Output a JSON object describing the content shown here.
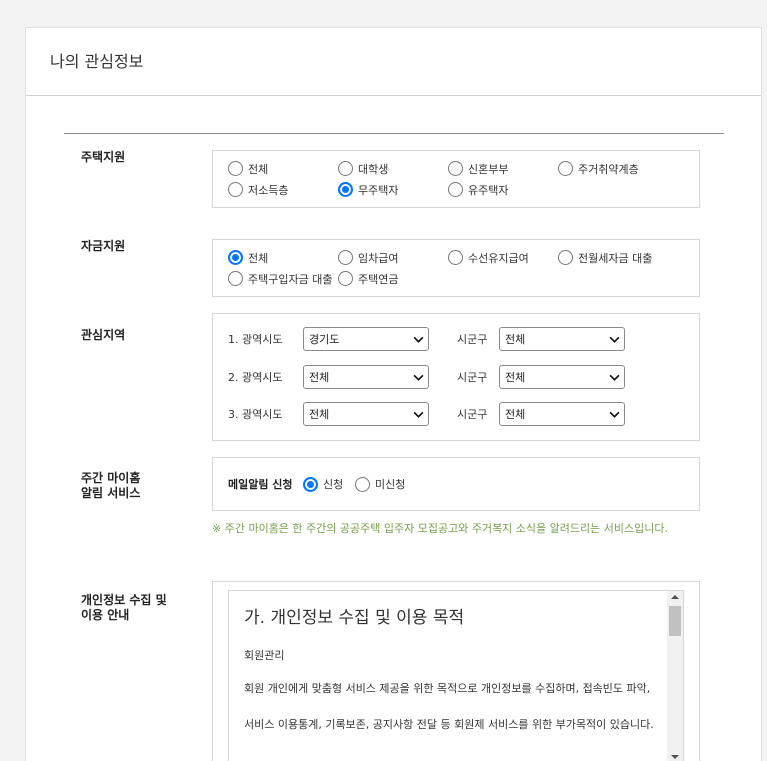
{
  "page": {
    "title": "나의 관심정보"
  },
  "colors": {
    "accent": "#0075ff",
    "note": "#77a04c"
  },
  "housing_support": {
    "label": "주택지원",
    "options": [
      {
        "label": "전체",
        "checked": false
      },
      {
        "label": "대학생",
        "checked": false
      },
      {
        "label": "신혼부부",
        "checked": false
      },
      {
        "label": "주거취약계층",
        "checked": false
      },
      {
        "label": "저소득층",
        "checked": false
      },
      {
        "label": "무주택자",
        "checked": true
      },
      {
        "label": "유주택자",
        "checked": false
      }
    ]
  },
  "fund_support": {
    "label": "자금지원",
    "options": [
      {
        "label": "전체",
        "checked": true
      },
      {
        "label": "임차급여",
        "checked": false
      },
      {
        "label": "수선유지급여",
        "checked": false
      },
      {
        "label": "전월세자금 대출",
        "checked": false
      },
      {
        "label": "주택구입자금 대출",
        "checked": false
      },
      {
        "label": "주택연금",
        "checked": false
      }
    ]
  },
  "region": {
    "label": "관심지역",
    "rows": [
      {
        "sido_label": "1. 광역시도",
        "sido_value": "경기도",
        "sigungu_label": "시군구",
        "sigungu_value": "전체"
      },
      {
        "sido_label": "2. 광역시도",
        "sido_value": "전체",
        "sigungu_label": "시군구",
        "sigungu_value": "전체"
      },
      {
        "sido_label": "3. 광역시도",
        "sido_value": "전체",
        "sigungu_label": "시군구",
        "sigungu_value": "전체"
      }
    ]
  },
  "weekly_alert": {
    "label_line1": "주간 마이홈",
    "label_line2": "알림 서비스",
    "field_label": "메일알림 신청",
    "options": [
      {
        "label": "신청",
        "checked": true
      },
      {
        "label": "미신청",
        "checked": false
      }
    ],
    "note": "※ 주간 마이홈은 한 주간의 공공주택 입주자 모집공고와 주거복지 소식을 알려드리는 서비스입니다."
  },
  "privacy": {
    "label_line1": "개인정보 수집 및",
    "label_line2": "이용 안내",
    "heading": "가. 개인정보 수집 및 이용 목적",
    "subheading": "회원관리",
    "paragraph": "회원 개인에게 맞춤형 서비스 제공을 위한 목적으로 개인정보를 수집하며, 접속빈도 파악, 서비스 이용통계, 기록보존, 공지사항 전달 등 회원제 서비스를 위한 부가목적이 있습니다.",
    "scroll_position": 0
  }
}
